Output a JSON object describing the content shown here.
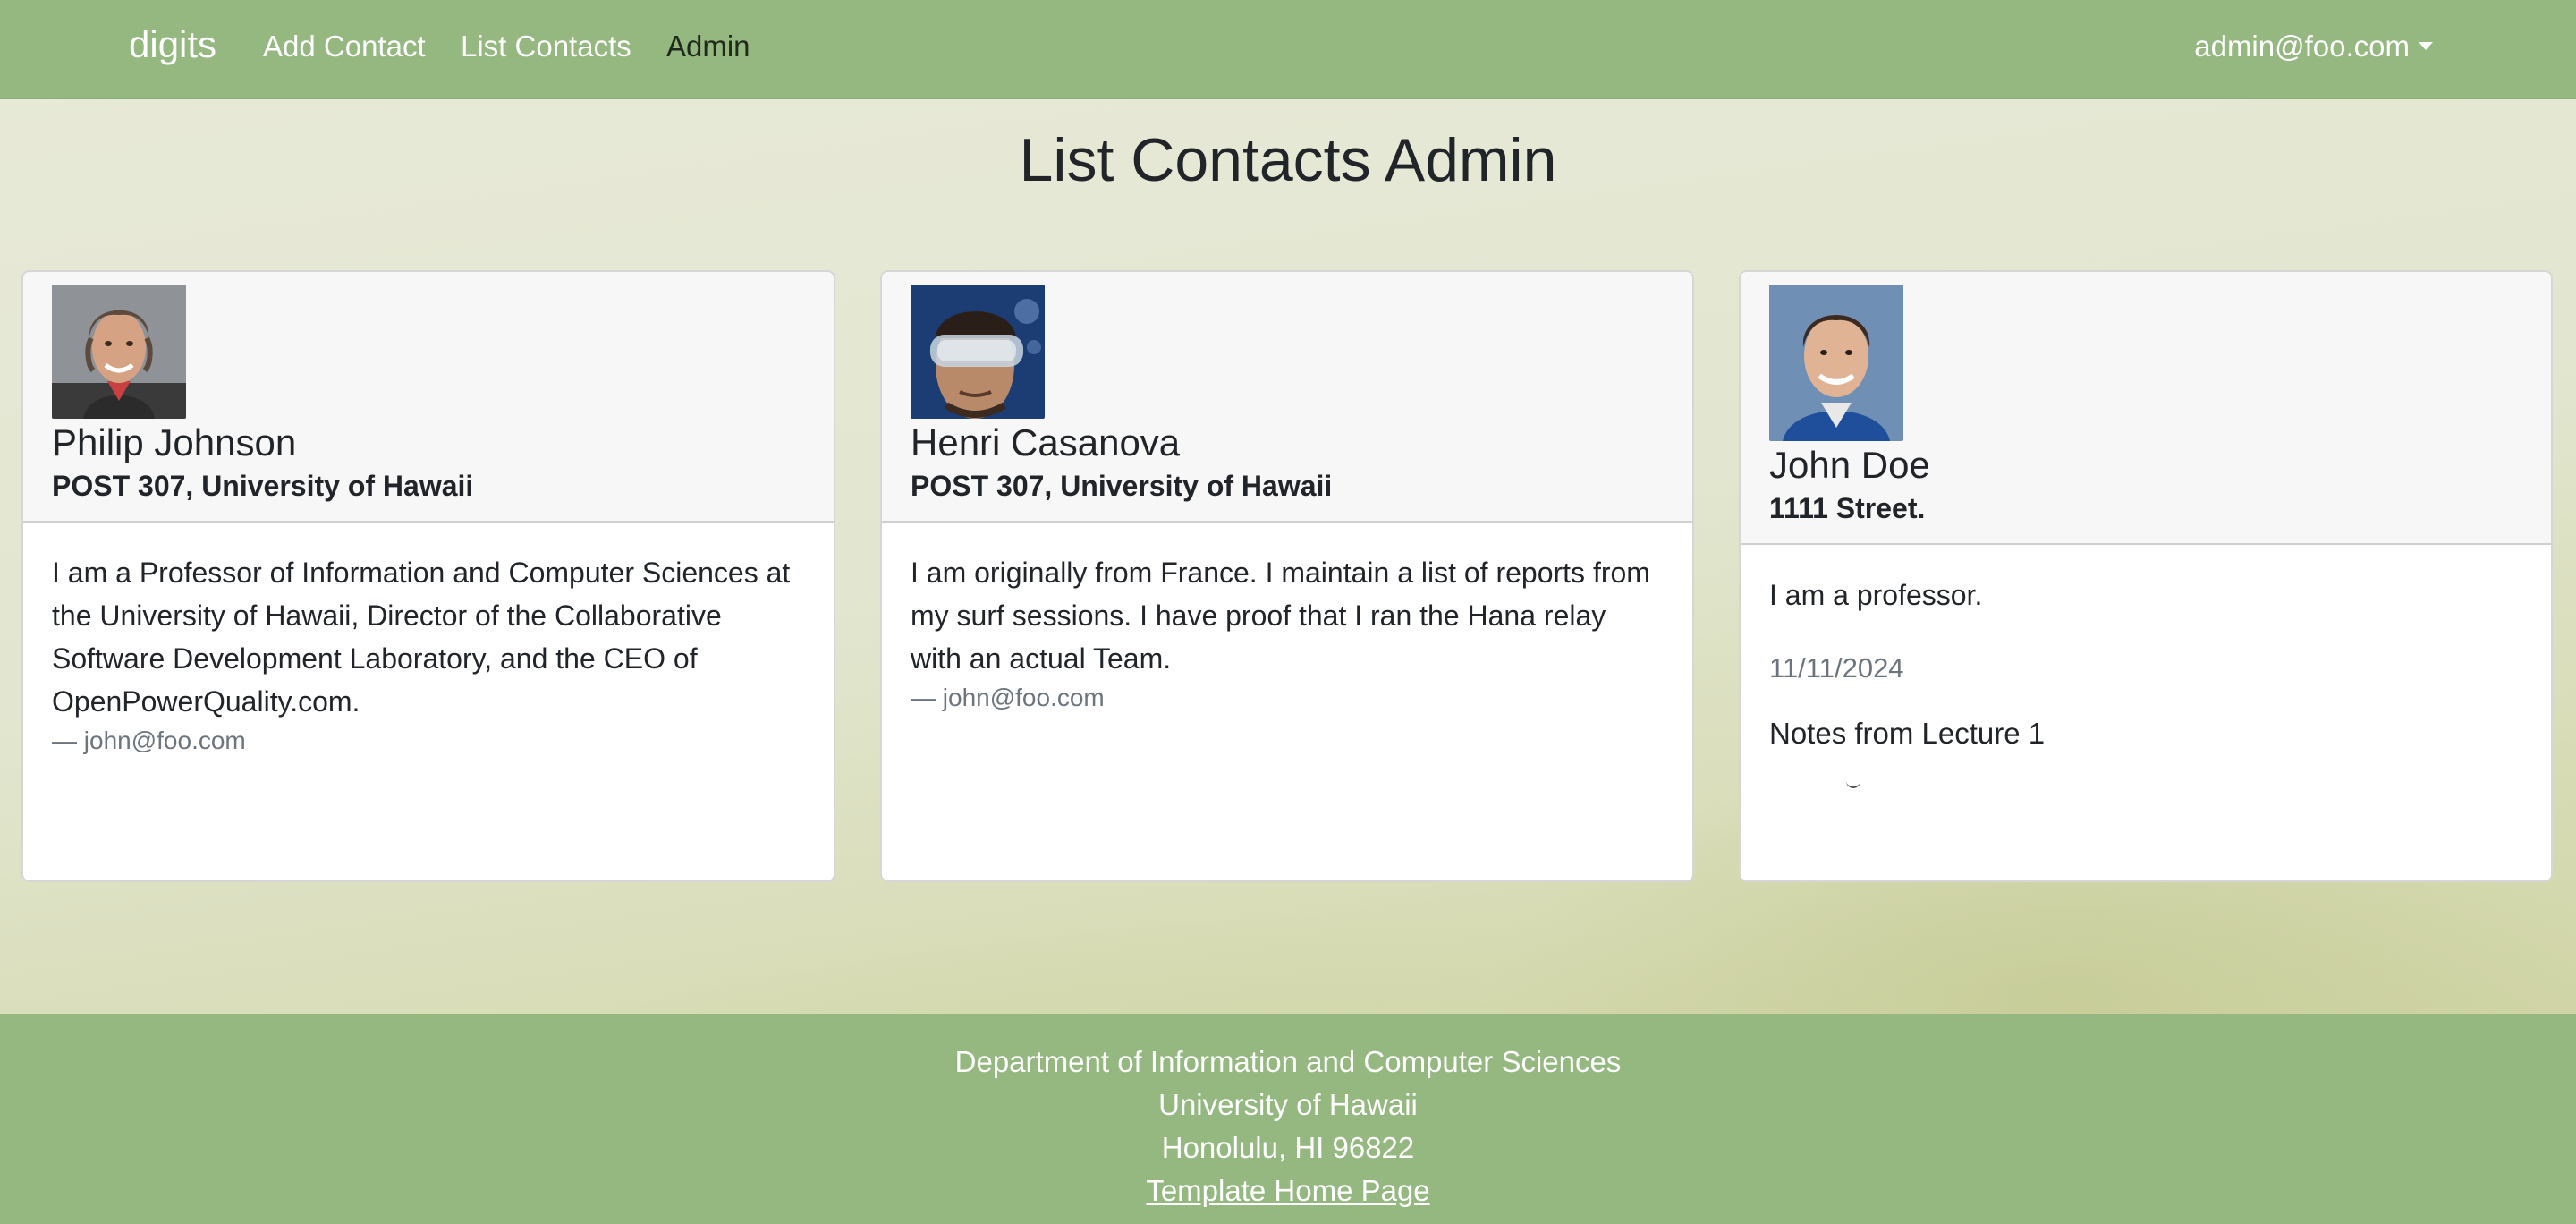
{
  "nav": {
    "brand": "digits",
    "links": [
      "Add Contact",
      "List Contacts",
      "Admin"
    ],
    "user": "admin@foo.com"
  },
  "page": {
    "title": "List Contacts Admin"
  },
  "contacts": [
    {
      "name": "Philip Johnson",
      "address": "POST 307, University of Hawaii",
      "description": "I am a Professor of Information and Computer Sciences at the University of Hawaii, Director of the Collaborative Software Development Laboratory, and the CEO of OpenPowerQuality.com.",
      "email": "— john@foo.com"
    },
    {
      "name": "Henri Casanova",
      "address": "POST 307, University of Hawaii",
      "description": "I am originally from France. I maintain a list of reports from my surf sessions. I have proof that I ran the Hana relay with an actual Team.",
      "email": "— john@foo.com"
    },
    {
      "name": "John Doe",
      "address": "1111 Street.",
      "description": "I am a professor.",
      "note": {
        "date": "11/11/2024",
        "text": "Notes from Lecture 1"
      }
    }
  ],
  "footer": {
    "line1": "Department of Information and Computer Sciences",
    "line2": "University of Hawaii",
    "line3": "Honolulu, HI 96822",
    "link": "Template Home Page"
  }
}
